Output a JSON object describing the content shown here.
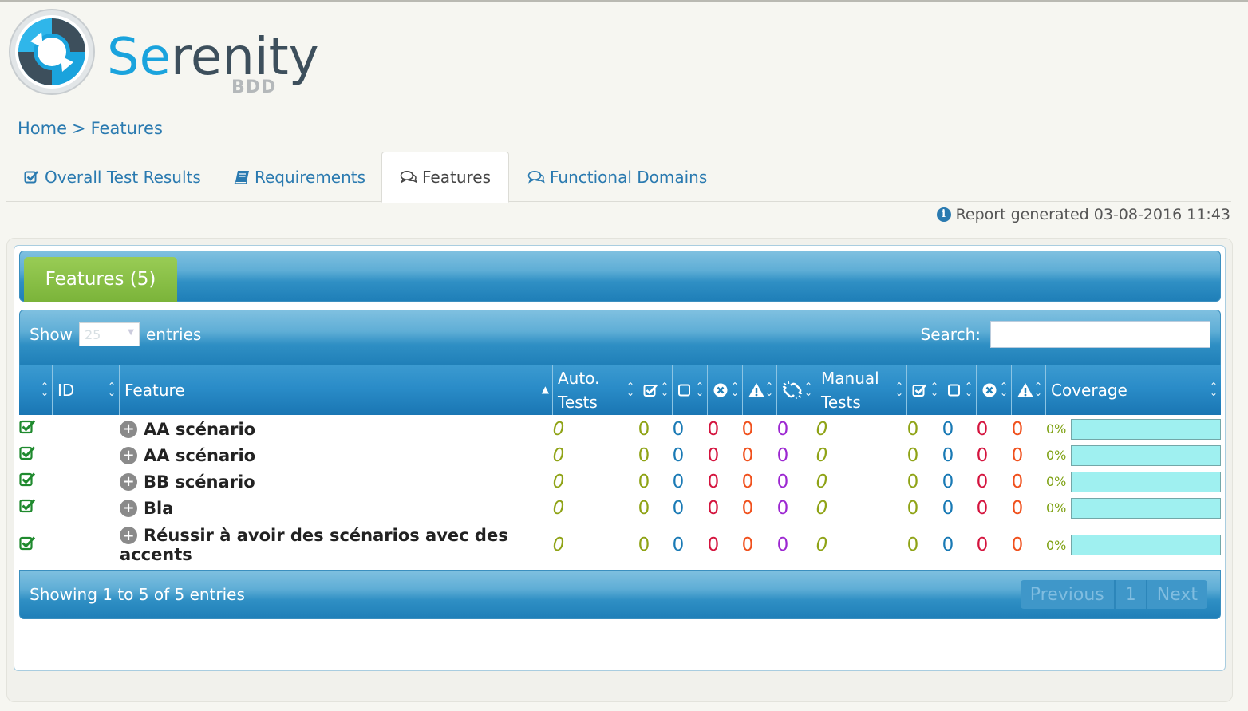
{
  "logo": {
    "se": "Se",
    "renity": "renity",
    "bdd": "BDD"
  },
  "breadcrumb": {
    "home": "Home",
    "separator": ">",
    "current": "Features"
  },
  "tabs": [
    {
      "label": "Overall Test Results",
      "icon": "checkbox-icon"
    },
    {
      "label": "Requirements",
      "icon": "book-icon"
    },
    {
      "label": "Features",
      "icon": "comments-icon",
      "active": true
    },
    {
      "label": "Functional Domains",
      "icon": "comments-icon"
    }
  ],
  "report_generated": "Report generated 03-08-2016 11:43",
  "panel": {
    "title": "Features (5)"
  },
  "controls": {
    "show": "Show",
    "page_size": "25",
    "entries": "entries",
    "search_label": "Search:"
  },
  "columns": {
    "id": "ID",
    "feature": "Feature",
    "auto_line1": "Auto.",
    "auto_line2": "Tests",
    "manual_line1": "Manual",
    "manual_line2": "Tests",
    "coverage": "Coverage"
  },
  "rows": [
    {
      "feature_line1": "AA scénario",
      "feature_line2": "",
      "auto": "0",
      "a_pass": "0",
      "a_pending": "0",
      "a_fail": "0",
      "a_error": "0",
      "a_compromised": "0",
      "manual": "0",
      "m_pass": "0",
      "m_pending": "0",
      "m_fail": "0",
      "m_error": "0",
      "coverage": "0%",
      "coverage_fraction": 0
    },
    {
      "feature_line1": "AA scénario",
      "feature_line2": "",
      "auto": "0",
      "a_pass": "0",
      "a_pending": "0",
      "a_fail": "0",
      "a_error": "0",
      "a_compromised": "0",
      "manual": "0",
      "m_pass": "0",
      "m_pending": "0",
      "m_fail": "0",
      "m_error": "0",
      "coverage": "0%",
      "coverage_fraction": 0
    },
    {
      "feature_line1": "BB scénario",
      "feature_line2": "",
      "auto": "0",
      "a_pass": "0",
      "a_pending": "0",
      "a_fail": "0",
      "a_error": "0",
      "a_compromised": "0",
      "manual": "0",
      "m_pass": "0",
      "m_pending": "0",
      "m_fail": "0",
      "m_error": "0",
      "coverage": "0%",
      "coverage_fraction": 0
    },
    {
      "feature_line1": "Bla",
      "feature_line2": "",
      "auto": "0",
      "a_pass": "0",
      "a_pending": "0",
      "a_fail": "0",
      "a_error": "0",
      "a_compromised": "0",
      "manual": "0",
      "m_pass": "0",
      "m_pending": "0",
      "m_fail": "0",
      "m_error": "0",
      "coverage": "0%",
      "coverage_fraction": 0
    },
    {
      "feature_line1": "Réussir à avoir des scénarios avec des",
      "feature_line2": "accents",
      "auto": "0",
      "a_pass": "0",
      "a_pending": "0",
      "a_fail": "0",
      "a_error": "0",
      "a_compromised": "0",
      "manual": "0",
      "m_pass": "0",
      "m_pending": "0",
      "m_fail": "0",
      "m_error": "0",
      "coverage": "0%",
      "coverage_fraction": 0
    }
  ],
  "footer": {
    "showing": "Showing 1 to 5 of 5 entries",
    "previous": "Previous",
    "page": "1",
    "next": "Next"
  },
  "colors": {
    "auto_total": "#8fa316",
    "pass": "#8fa316",
    "pending": "#1a7ab5",
    "failure": "#d4143e",
    "error": "#f0501c",
    "compromised": "#9c27d1",
    "link": "#2a7ab0",
    "panel_green": "#7bb43a",
    "coverage_bar": "#9ff0f0"
  }
}
